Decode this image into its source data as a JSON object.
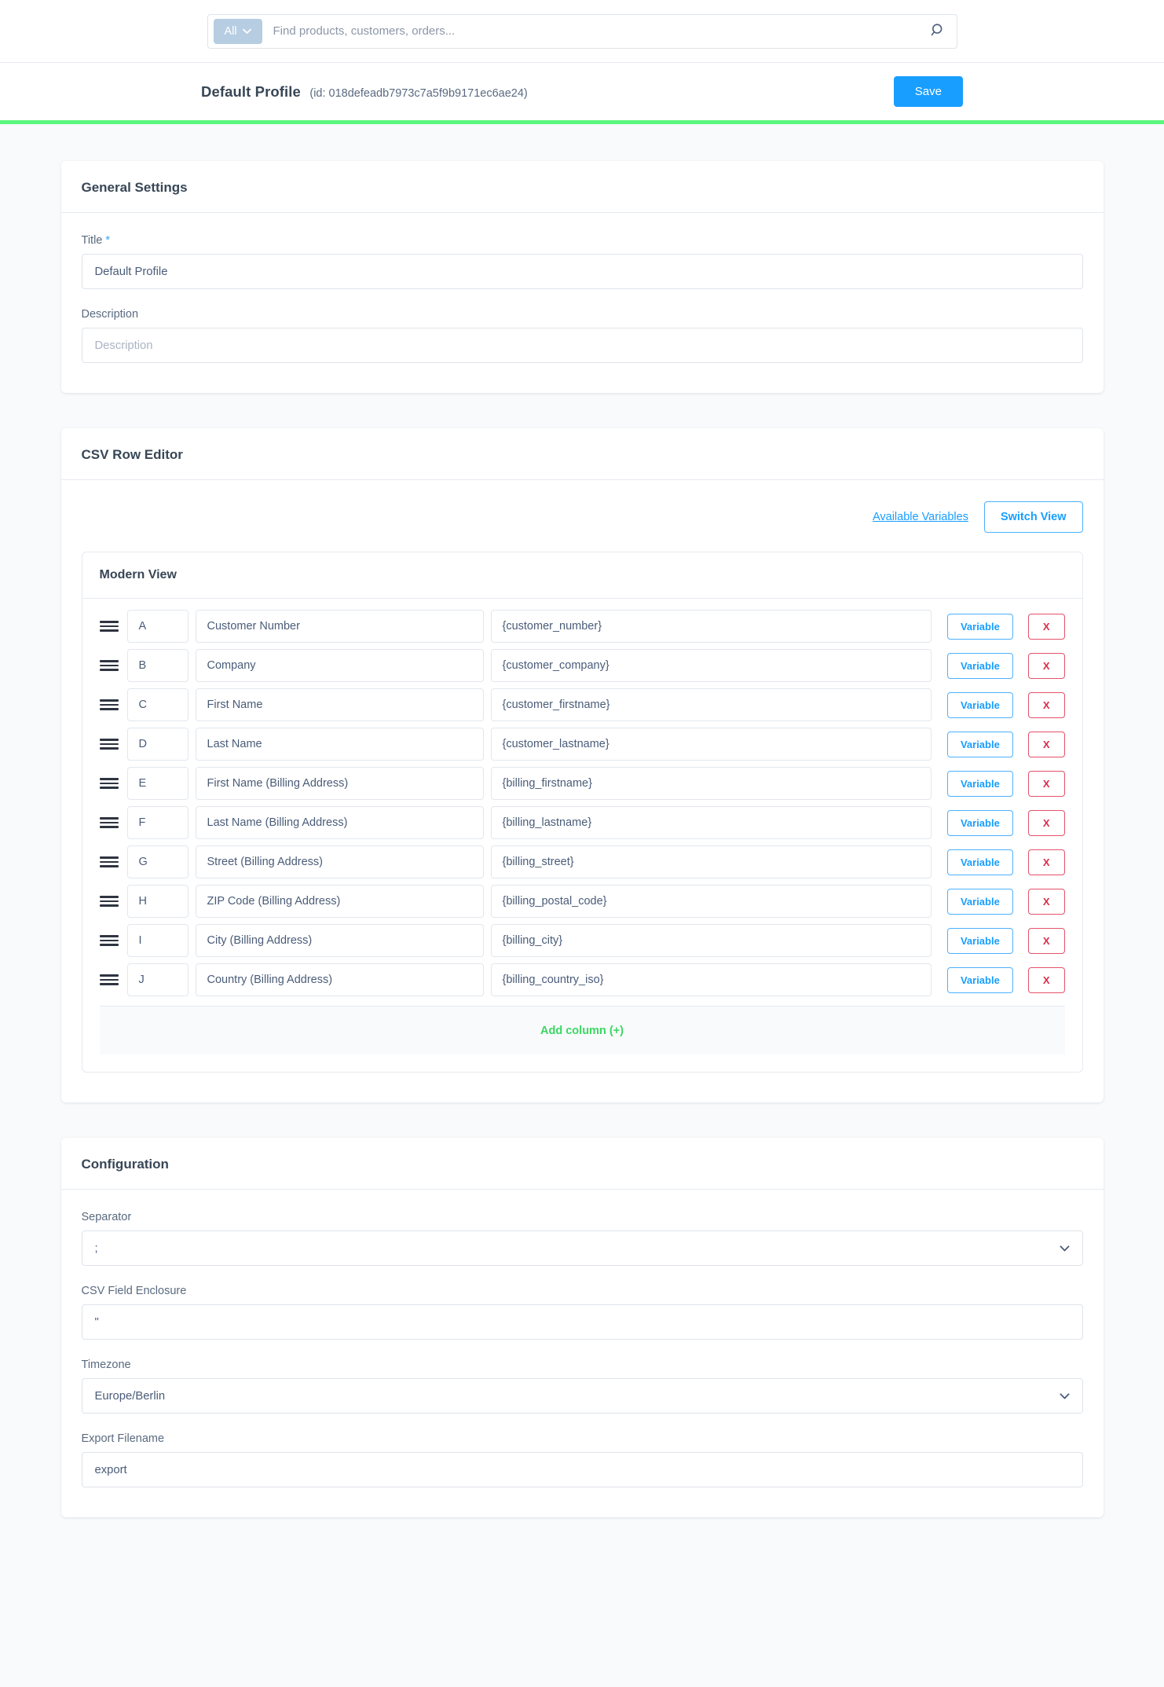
{
  "search": {
    "scope_label": "All",
    "placeholder": "Find products, customers, orders...",
    "value": ""
  },
  "page_header": {
    "title": "Default Profile",
    "id_text": "(id: 018defeadb7973c7a5f9b9171ec6ae24)",
    "save_label": "Save",
    "accent_save": "#189eff",
    "progress_color": "#5cf77f"
  },
  "general_settings": {
    "card_title": "General Settings",
    "title_label": "Title",
    "title_required_mark": "*",
    "title_value": "Default Profile",
    "description_label": "Description",
    "description_value": "",
    "description_placeholder": "Description"
  },
  "csv_row_editor": {
    "card_title": "CSV Row Editor",
    "available_variables_label": "Available Variables",
    "switch_view_label": "Switch View",
    "view_title": "Modern View",
    "add_column_label": "Add column (+)",
    "variable_button_label": "Variable",
    "remove_button_label": "X",
    "rows": [
      {
        "letter": "A",
        "name": "Customer Number",
        "variable": "{customer_number}"
      },
      {
        "letter": "B",
        "name": "Company",
        "variable": "{customer_company}"
      },
      {
        "letter": "C",
        "name": "First Name",
        "variable": "{customer_firstname}"
      },
      {
        "letter": "D",
        "name": "Last Name",
        "variable": "{customer_lastname}"
      },
      {
        "letter": "E",
        "name": "First Name (Billing Address)",
        "variable": "{billing_firstname}"
      },
      {
        "letter": "F",
        "name": "Last Name (Billing Address)",
        "variable": "{billing_lastname}"
      },
      {
        "letter": "G",
        "name": "Street (Billing Address)",
        "variable": "{billing_street}"
      },
      {
        "letter": "H",
        "name": "ZIP Code (Billing Address)",
        "variable": "{billing_postal_code}"
      },
      {
        "letter": "I",
        "name": "City (Billing Address)",
        "variable": "{billing_city}"
      },
      {
        "letter": "J",
        "name": "Country (Billing Address)",
        "variable": "{billing_country_iso}"
      }
    ]
  },
  "configuration": {
    "card_title": "Configuration",
    "separator_label": "Separator",
    "separator_value": ";",
    "enclosure_label": "CSV Field Enclosure",
    "enclosure_value": "\"",
    "timezone_label": "Timezone",
    "timezone_value": "Europe/Berlin",
    "filename_label": "Export Filename",
    "filename_value": "export"
  }
}
